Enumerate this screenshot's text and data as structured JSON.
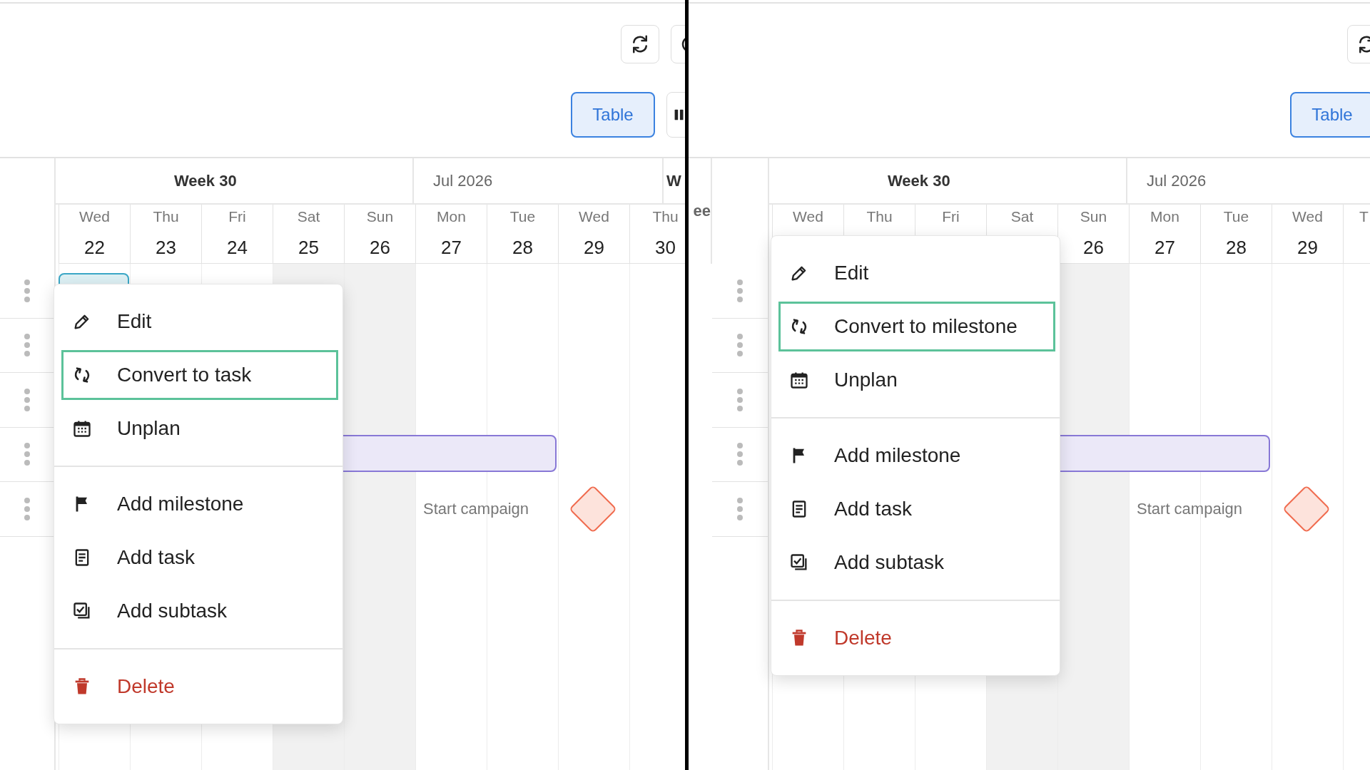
{
  "panels": [
    {
      "toolbar": {
        "actions": [
          {
            "kind": "refresh"
          },
          {
            "kind": "circle"
          }
        ],
        "views": [
          {
            "kind": "text",
            "label": "Table",
            "selected": true
          },
          {
            "kind": "columns",
            "selected": false
          }
        ]
      },
      "weeks": [
        {
          "kind": "week",
          "label": "Week 30"
        },
        {
          "kind": "month",
          "label": "Jul 2026"
        },
        {
          "kind": "week",
          "label": "W"
        }
      ],
      "days": [
        {
          "name": "Wed",
          "number": "22",
          "weekend": false
        },
        {
          "name": "Thu",
          "number": "23",
          "weekend": false
        },
        {
          "name": "Fri",
          "number": "24",
          "weekend": false
        },
        {
          "name": "Sat",
          "number": "25",
          "weekend": true
        },
        {
          "name": "Sun",
          "number": "26",
          "weekend": true
        },
        {
          "name": "Mon",
          "number": "27",
          "weekend": false
        },
        {
          "name": "Tue",
          "number": "28",
          "weekend": false
        },
        {
          "name": "Wed",
          "number": "29",
          "weekend": false
        },
        {
          "name": "Thu",
          "number": "30",
          "weekend": false
        }
      ],
      "rows": [
        {
          "kind": "task"
        },
        {
          "kind": "empty"
        },
        {
          "kind": "empty"
        },
        {
          "kind": "bar"
        },
        {
          "kind": "milestone",
          "label": "Start campaign"
        }
      ],
      "menu": {
        "groups": [
          {
            "items": [
              {
                "kind": "edit",
                "label": "Edit",
                "selected": false
              },
              {
                "kind": "convert",
                "label": "Convert to task",
                "selected": true
              },
              {
                "kind": "unplan",
                "label": "Unplan",
                "selected": false
              }
            ]
          },
          {
            "items": [
              {
                "kind": "add-milestone",
                "label": "Add milestone",
                "selected": false
              },
              {
                "kind": "add-task",
                "label": "Add task",
                "selected": false
              },
              {
                "kind": "add-subtask",
                "label": "Add subtask",
                "selected": false
              }
            ]
          },
          {
            "items": [
              {
                "kind": "delete",
                "label": "Delete",
                "selected": false
              }
            ]
          }
        ]
      }
    },
    {
      "toolbar": {
        "actions": [
          {
            "kind": "refresh"
          }
        ],
        "views": [
          {
            "kind": "text",
            "label": "Table",
            "selected": true
          }
        ]
      },
      "columns": [
        {
          "label": "ee"
        }
      ],
      "weeks": [
        {
          "kind": "week",
          "label": "Week 30"
        },
        {
          "kind": "month",
          "label": "Jul 2026"
        }
      ],
      "days": [
        {
          "name": "Wed",
          "weekend": false
        },
        {
          "name": "Thu",
          "weekend": false
        },
        {
          "name": "Fri",
          "weekend": false
        },
        {
          "name": "Sat",
          "weekend": true
        },
        {
          "name": "Sun",
          "number": "26",
          "weekend": true
        },
        {
          "name": "Mon",
          "number": "27",
          "weekend": false
        },
        {
          "name": "Tue",
          "number": "28",
          "weekend": false
        },
        {
          "name": "Wed",
          "number": "29",
          "weekend": false
        },
        {
          "name": "T",
          "weekend": false
        }
      ],
      "rows": [
        {
          "kind": "empty"
        },
        {
          "kind": "empty"
        },
        {
          "kind": "empty"
        },
        {
          "kind": "bar"
        },
        {
          "kind": "milestone",
          "label": "Start campaign"
        }
      ],
      "menu": {
        "groups": [
          {
            "items": [
              {
                "kind": "edit",
                "label": "Edit",
                "selected": false
              },
              {
                "kind": "convert",
                "label": "Convert to milestone",
                "selected": true
              },
              {
                "kind": "unplan",
                "label": "Unplan",
                "selected": false
              }
            ]
          },
          {
            "items": [
              {
                "kind": "add-milestone",
                "label": "Add milestone",
                "selected": false
              },
              {
                "kind": "add-task",
                "label": "Add task",
                "selected": false
              },
              {
                "kind": "add-subtask",
                "label": "Add subtask",
                "selected": false
              }
            ]
          },
          {
            "items": [
              {
                "kind": "delete",
                "label": "Delete",
                "selected": false
              }
            ]
          }
        ]
      }
    }
  ]
}
